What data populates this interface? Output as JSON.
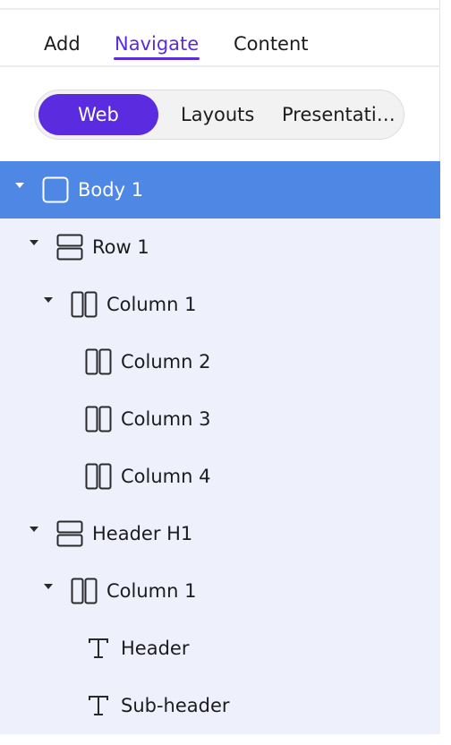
{
  "tabs": {
    "add": "Add",
    "navigate": "Navigate",
    "content": "Content",
    "active": "Navigate"
  },
  "view_switch": {
    "web": "Web",
    "layouts": "Layouts",
    "presentation": "Presentati…",
    "selected": "Web"
  },
  "colors": {
    "accent": "#5b2be0",
    "selected_row": "#4f87e5",
    "tree_background": "#eef0fb"
  },
  "tree": [
    {
      "label": "Body 1",
      "icon": "body-icon",
      "expanded": true,
      "selected": true
    },
    {
      "label": "Row 1",
      "icon": "row-icon",
      "expanded": true
    },
    {
      "label": "Column 1",
      "icon": "column-icon",
      "expanded": true
    },
    {
      "label": "Column 2",
      "icon": "column-icon"
    },
    {
      "label": "Column 3",
      "icon": "column-icon"
    },
    {
      "label": "Column 4",
      "icon": "column-icon"
    },
    {
      "label": "Header H1",
      "icon": "row-icon",
      "expanded": true
    },
    {
      "label": "Column 1",
      "icon": "column-icon",
      "expanded": true
    },
    {
      "label": "Header",
      "icon": "text-icon"
    },
    {
      "label": "Sub-header",
      "icon": "text-icon"
    }
  ]
}
